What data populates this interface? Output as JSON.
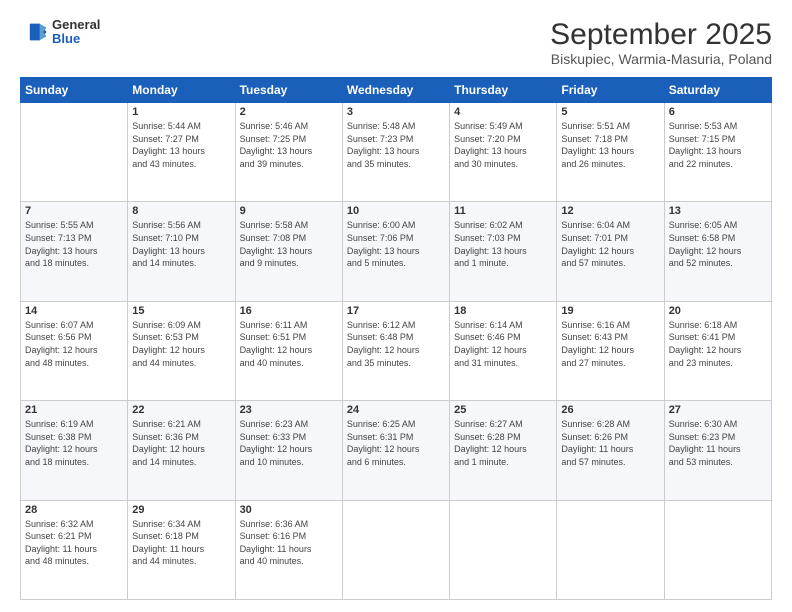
{
  "header": {
    "logo": {
      "general": "General",
      "blue": "Blue"
    },
    "title": "September 2025",
    "subtitle": "Biskupiec, Warmia-Masuria, Poland"
  },
  "days_of_week": [
    "Sunday",
    "Monday",
    "Tuesday",
    "Wednesday",
    "Thursday",
    "Friday",
    "Saturday"
  ],
  "weeks": [
    [
      {
        "day": "",
        "lines": []
      },
      {
        "day": "1",
        "lines": [
          "Sunrise: 5:44 AM",
          "Sunset: 7:27 PM",
          "Daylight: 13 hours",
          "and 43 minutes."
        ]
      },
      {
        "day": "2",
        "lines": [
          "Sunrise: 5:46 AM",
          "Sunset: 7:25 PM",
          "Daylight: 13 hours",
          "and 39 minutes."
        ]
      },
      {
        "day": "3",
        "lines": [
          "Sunrise: 5:48 AM",
          "Sunset: 7:23 PM",
          "Daylight: 13 hours",
          "and 35 minutes."
        ]
      },
      {
        "day": "4",
        "lines": [
          "Sunrise: 5:49 AM",
          "Sunset: 7:20 PM",
          "Daylight: 13 hours",
          "and 30 minutes."
        ]
      },
      {
        "day": "5",
        "lines": [
          "Sunrise: 5:51 AM",
          "Sunset: 7:18 PM",
          "Daylight: 13 hours",
          "and 26 minutes."
        ]
      },
      {
        "day": "6",
        "lines": [
          "Sunrise: 5:53 AM",
          "Sunset: 7:15 PM",
          "Daylight: 13 hours",
          "and 22 minutes."
        ]
      }
    ],
    [
      {
        "day": "7",
        "lines": [
          "Sunrise: 5:55 AM",
          "Sunset: 7:13 PM",
          "Daylight: 13 hours",
          "and 18 minutes."
        ]
      },
      {
        "day": "8",
        "lines": [
          "Sunrise: 5:56 AM",
          "Sunset: 7:10 PM",
          "Daylight: 13 hours",
          "and 14 minutes."
        ]
      },
      {
        "day": "9",
        "lines": [
          "Sunrise: 5:58 AM",
          "Sunset: 7:08 PM",
          "Daylight: 13 hours",
          "and 9 minutes."
        ]
      },
      {
        "day": "10",
        "lines": [
          "Sunrise: 6:00 AM",
          "Sunset: 7:06 PM",
          "Daylight: 13 hours",
          "and 5 minutes."
        ]
      },
      {
        "day": "11",
        "lines": [
          "Sunrise: 6:02 AM",
          "Sunset: 7:03 PM",
          "Daylight: 13 hours",
          "and 1 minute."
        ]
      },
      {
        "day": "12",
        "lines": [
          "Sunrise: 6:04 AM",
          "Sunset: 7:01 PM",
          "Daylight: 12 hours",
          "and 57 minutes."
        ]
      },
      {
        "day": "13",
        "lines": [
          "Sunrise: 6:05 AM",
          "Sunset: 6:58 PM",
          "Daylight: 12 hours",
          "and 52 minutes."
        ]
      }
    ],
    [
      {
        "day": "14",
        "lines": [
          "Sunrise: 6:07 AM",
          "Sunset: 6:56 PM",
          "Daylight: 12 hours",
          "and 48 minutes."
        ]
      },
      {
        "day": "15",
        "lines": [
          "Sunrise: 6:09 AM",
          "Sunset: 6:53 PM",
          "Daylight: 12 hours",
          "and 44 minutes."
        ]
      },
      {
        "day": "16",
        "lines": [
          "Sunrise: 6:11 AM",
          "Sunset: 6:51 PM",
          "Daylight: 12 hours",
          "and 40 minutes."
        ]
      },
      {
        "day": "17",
        "lines": [
          "Sunrise: 6:12 AM",
          "Sunset: 6:48 PM",
          "Daylight: 12 hours",
          "and 35 minutes."
        ]
      },
      {
        "day": "18",
        "lines": [
          "Sunrise: 6:14 AM",
          "Sunset: 6:46 PM",
          "Daylight: 12 hours",
          "and 31 minutes."
        ]
      },
      {
        "day": "19",
        "lines": [
          "Sunrise: 6:16 AM",
          "Sunset: 6:43 PM",
          "Daylight: 12 hours",
          "and 27 minutes."
        ]
      },
      {
        "day": "20",
        "lines": [
          "Sunrise: 6:18 AM",
          "Sunset: 6:41 PM",
          "Daylight: 12 hours",
          "and 23 minutes."
        ]
      }
    ],
    [
      {
        "day": "21",
        "lines": [
          "Sunrise: 6:19 AM",
          "Sunset: 6:38 PM",
          "Daylight: 12 hours",
          "and 18 minutes."
        ]
      },
      {
        "day": "22",
        "lines": [
          "Sunrise: 6:21 AM",
          "Sunset: 6:36 PM",
          "Daylight: 12 hours",
          "and 14 minutes."
        ]
      },
      {
        "day": "23",
        "lines": [
          "Sunrise: 6:23 AM",
          "Sunset: 6:33 PM",
          "Daylight: 12 hours",
          "and 10 minutes."
        ]
      },
      {
        "day": "24",
        "lines": [
          "Sunrise: 6:25 AM",
          "Sunset: 6:31 PM",
          "Daylight: 12 hours",
          "and 6 minutes."
        ]
      },
      {
        "day": "25",
        "lines": [
          "Sunrise: 6:27 AM",
          "Sunset: 6:28 PM",
          "Daylight: 12 hours",
          "and 1 minute."
        ]
      },
      {
        "day": "26",
        "lines": [
          "Sunrise: 6:28 AM",
          "Sunset: 6:26 PM",
          "Daylight: 11 hours",
          "and 57 minutes."
        ]
      },
      {
        "day": "27",
        "lines": [
          "Sunrise: 6:30 AM",
          "Sunset: 6:23 PM",
          "Daylight: 11 hours",
          "and 53 minutes."
        ]
      }
    ],
    [
      {
        "day": "28",
        "lines": [
          "Sunrise: 6:32 AM",
          "Sunset: 6:21 PM",
          "Daylight: 11 hours",
          "and 48 minutes."
        ]
      },
      {
        "day": "29",
        "lines": [
          "Sunrise: 6:34 AM",
          "Sunset: 6:18 PM",
          "Daylight: 11 hours",
          "and 44 minutes."
        ]
      },
      {
        "day": "30",
        "lines": [
          "Sunrise: 6:36 AM",
          "Sunset: 6:16 PM",
          "Daylight: 11 hours",
          "and 40 minutes."
        ]
      },
      {
        "day": "",
        "lines": []
      },
      {
        "day": "",
        "lines": []
      },
      {
        "day": "",
        "lines": []
      },
      {
        "day": "",
        "lines": []
      }
    ]
  ]
}
